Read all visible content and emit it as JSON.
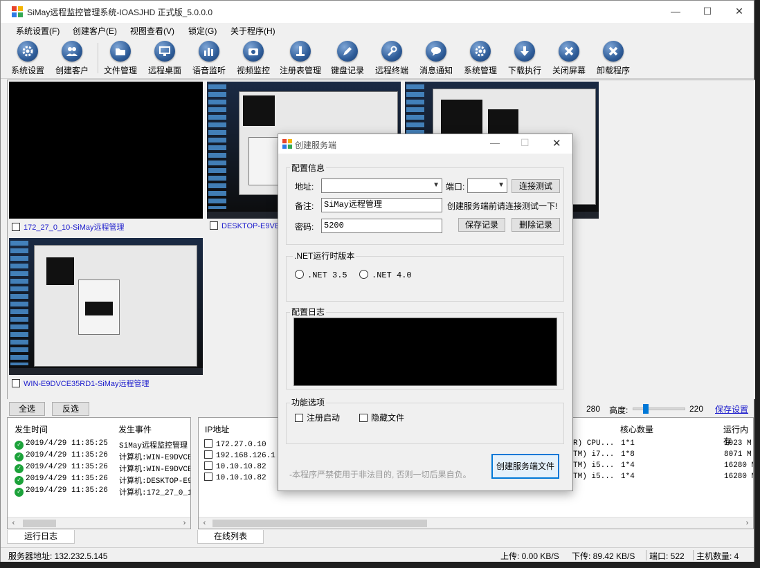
{
  "window": {
    "title": "SiMay远程监控管理系统-IOASJHD 正式版_5.0.0.0",
    "controls": {
      "minimize": "—",
      "maximize": "☐",
      "close": "✕"
    }
  },
  "menu": [
    "系统设置(F)",
    "创建客户(E)",
    "视图查看(V)",
    "锁定(G)",
    "关于程序(H)"
  ],
  "toolbar": [
    {
      "label": "系统设置",
      "icon": "gear-icon"
    },
    {
      "label": "创建客户",
      "icon": "users-icon"
    },
    {
      "label": "文件管理",
      "icon": "folder-icon"
    },
    {
      "label": "远程桌面",
      "icon": "monitor-icon"
    },
    {
      "label": "语音监听",
      "icon": "audio-bars-icon"
    },
    {
      "label": "视频监控",
      "icon": "camera-icon"
    },
    {
      "label": "注册表管理",
      "icon": "registry-icon"
    },
    {
      "label": "键盘记录",
      "icon": "pen-icon"
    },
    {
      "label": "远程终端",
      "icon": "wrench-icon"
    },
    {
      "label": "消息通知",
      "icon": "chat-bubble-icon"
    },
    {
      "label": "系统管理",
      "icon": "gear-icon"
    },
    {
      "label": "下载执行",
      "icon": "download-arrow-icon"
    },
    {
      "label": "关闭屏幕",
      "icon": "close-x-icon"
    },
    {
      "label": "卸载程序",
      "icon": "close-x-icon"
    }
  ],
  "desktops": [
    {
      "caption": "172_27_0_10-SiMay远程管理"
    },
    {
      "caption": "DESKTOP-E9VESU"
    },
    {
      "caption": ""
    },
    {
      "caption": "WIN-E9DVCE35RD1-SiMay远程管理"
    }
  ],
  "controls": {
    "select_all": "全选",
    "invert": "反选",
    "width_value": "280",
    "height_label": "高度:",
    "height_value": "220",
    "save_settings": "保存设置"
  },
  "log_panel": {
    "headers": [
      "发生时间",
      "发生事件"
    ],
    "rows": [
      {
        "time": "2019/4/29 11:35:25",
        "event": "SiMay远程监控管理"
      },
      {
        "time": "2019/4/29 11:35:26",
        "event": "计算机:WIN-E9DVCE"
      },
      {
        "time": "2019/4/29 11:35:26",
        "event": "计算机:WIN-E9DVCE"
      },
      {
        "time": "2019/4/29 11:35:26",
        "event": "计算机:DESKTOP-E9"
      },
      {
        "time": "2019/4/29 11:35:26",
        "event": "计算机:172_27_0_1"
      }
    ],
    "tab": "运行日志"
  },
  "online_panel": {
    "headers": {
      "ip": "IP地址",
      "cores": "核心数量",
      "mem": "运行内存"
    },
    "rows": [
      {
        "ip": "172.27.0.10",
        "cpu": "R) CPU...",
        "cores": "1*1",
        "mem": "1023 M"
      },
      {
        "ip": "192.168.126.1",
        "cpu": "TM) i7...",
        "cores": "1*8",
        "mem": "8071 M"
      },
      {
        "ip": "10.10.10.82",
        "cpu": "TM) i5...",
        "cores": "1*4",
        "mem": "16280 M"
      },
      {
        "ip": "10.10.10.82",
        "cpu": "TM) i5...",
        "cores": "1*4",
        "mem": "16280 M"
      }
    ],
    "tab": "在线列表"
  },
  "statusbar": {
    "server": "服务器地址: 132.232.5.145",
    "upload": "上传: 0.00 KB/S",
    "download": "下传: 89.42 KB/S",
    "port": "端口: 522",
    "hosts": "主机数量: 4"
  },
  "dialog": {
    "title": "创建服务端",
    "group_config": "配置信息",
    "addr_label": "地址:",
    "addr_value": "",
    "port_label": "端口:",
    "port_value": "",
    "test_button": "连接测试",
    "remark_label": "备注:",
    "remark_value": "SiMay远程管理",
    "hint": "创建服务端前请连接测试一下!",
    "pwd_label": "密码:",
    "pwd_value": "5200",
    "save_button": "保存记录",
    "delete_button": "删除记录",
    "group_net": ".NET运行时版本",
    "net35": ".NET 3.5",
    "net40": ".NET 4.0",
    "group_log": "配置日志",
    "group_func": "功能选项",
    "autostart": "注册启动",
    "hidefile": "隐藏文件",
    "disclaimer": "-本程序严禁使用于非法目的, 否则一切后果自负。",
    "create_button": "创建服务端文件"
  }
}
